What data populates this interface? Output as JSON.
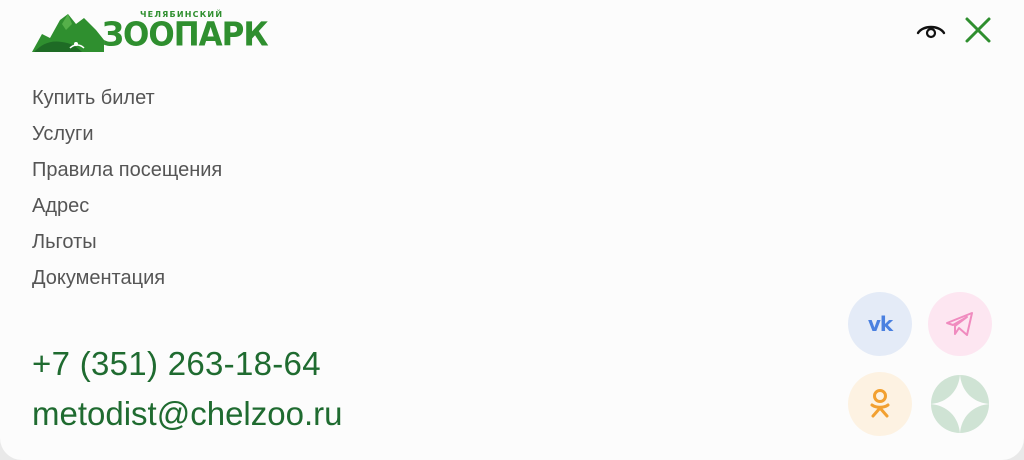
{
  "logo": {
    "small_text": "ЧЕЛЯБИНСКИЙ",
    "big_text": "ЗООПАРК"
  },
  "header": {
    "accessibility_icon": "eye-icon",
    "close_icon": "close-icon"
  },
  "nav": {
    "items": [
      {
        "label": "Купить билет"
      },
      {
        "label": "Услуги"
      },
      {
        "label": "Правила посещения"
      },
      {
        "label": "Адрес"
      },
      {
        "label": "Льготы"
      },
      {
        "label": "Документация"
      }
    ]
  },
  "contacts": {
    "phone": "+7 (351) 263-18-64",
    "email": "metodist@chelzoo.ru"
  },
  "social": {
    "vk_label": "vk",
    "items": [
      "vk-icon",
      "telegram-icon",
      "odnoklassniki-icon",
      "four-point-star-icon"
    ]
  },
  "colors": {
    "brand_green": "#2f8f2f",
    "contact_green": "#1f6b30",
    "nav_text": "#555555",
    "vk_blue": "#4a80e0",
    "telegram_pink": "#f08bbf",
    "ok_orange": "#f2a030",
    "star_green": "#cfe3d4"
  }
}
